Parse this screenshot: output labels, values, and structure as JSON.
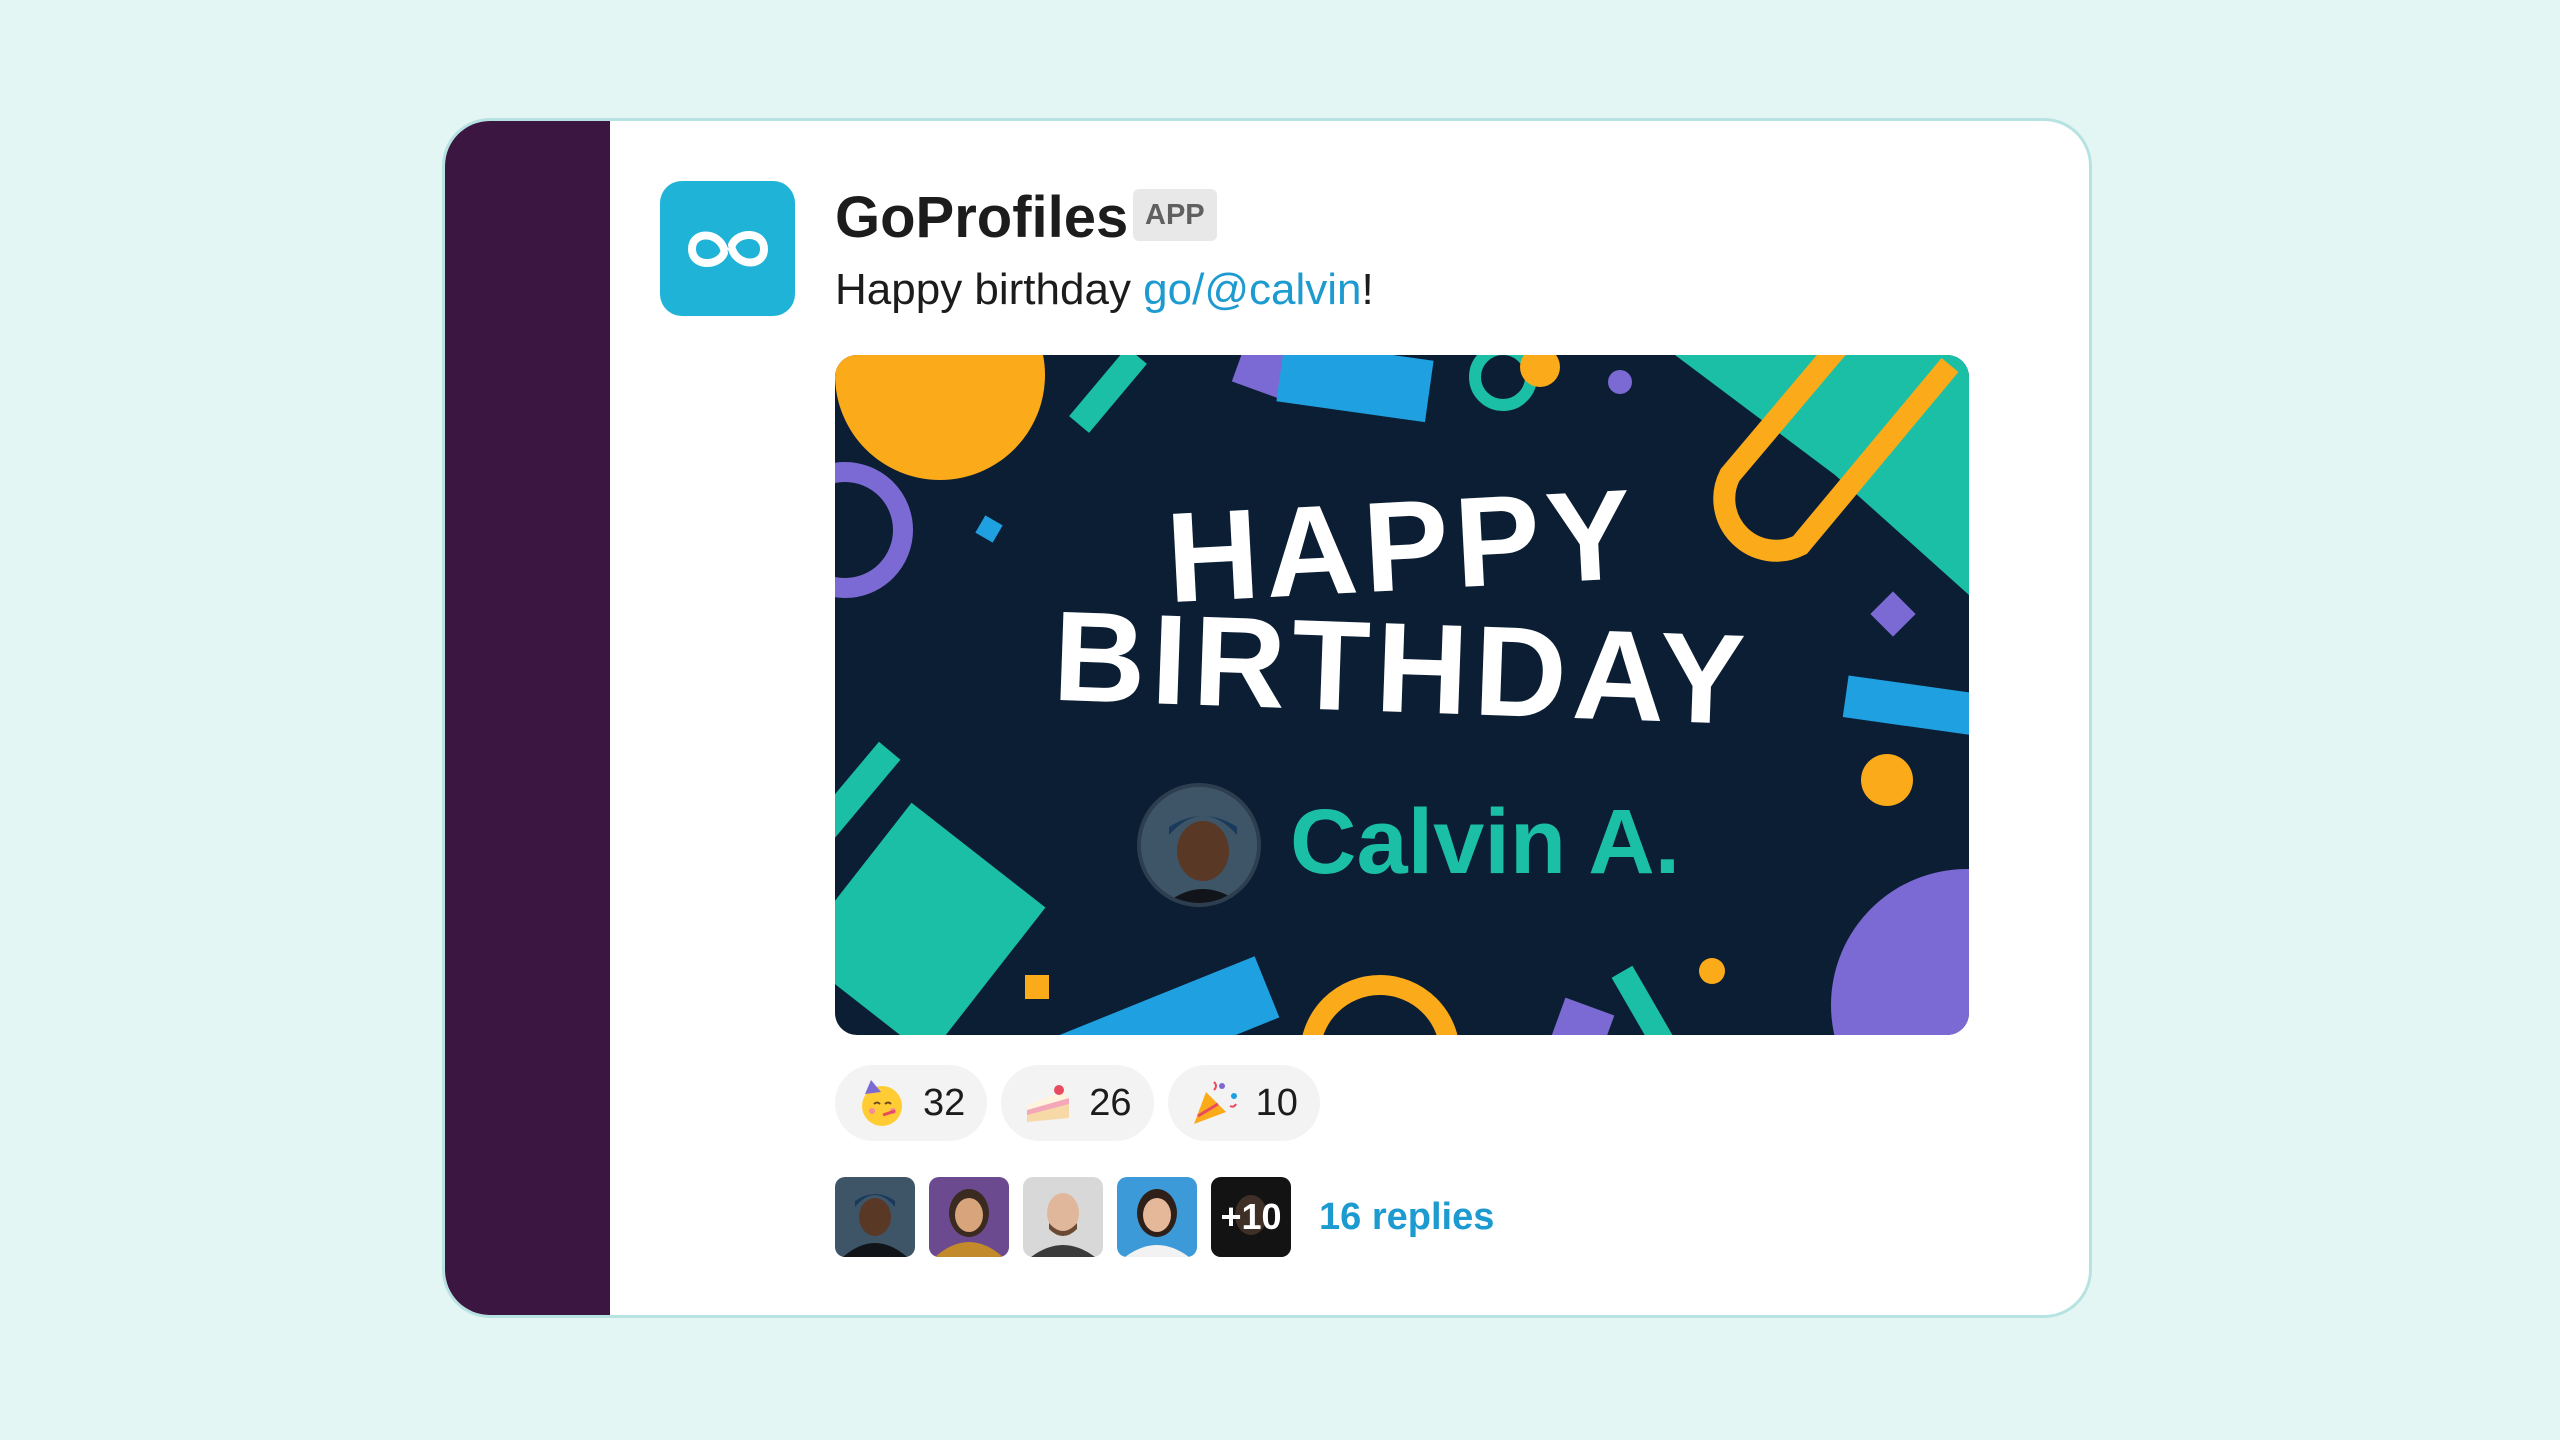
{
  "app": {
    "name": "GoProfiles",
    "badge": "APP",
    "icon": "goprofiles-logo-icon",
    "brand_color": "#1fb3d7"
  },
  "message": {
    "text": "Happy birthday ",
    "mention": "go/@calvin",
    "suffix": "!"
  },
  "banner": {
    "line1": "HAPPY",
    "line2": "BIRTHDAY",
    "person_name": "Calvin A.",
    "colors": {
      "background": "#0c1e33",
      "teal": "#1bbfa6",
      "yellow": "#fbaa19",
      "purple": "#7b6ad3",
      "blue": "#1fa0e0"
    }
  },
  "reactions": [
    {
      "emoji": "partying-face-emoji",
      "count": "32"
    },
    {
      "emoji": "cake-emoji",
      "count": "26"
    },
    {
      "emoji": "party-popper-emoji",
      "count": "10"
    }
  ],
  "thread": {
    "more_label": "+10",
    "replies_label": "16 replies"
  }
}
